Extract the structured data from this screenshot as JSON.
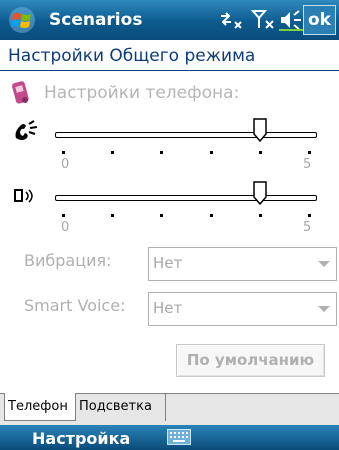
{
  "titlebar": {
    "app_title": "Scenarios",
    "ok_label": "ok",
    "icons": [
      "windows-logo-icon",
      "connectivity-icon",
      "signal-icon",
      "volume-icon"
    ],
    "colors": {
      "bar_top": "#2f89bd",
      "bar_bottom": "#0a4d7c"
    }
  },
  "page": {
    "heading": "Настройки Общего режима"
  },
  "phone_settings": {
    "label": "Настройки телефона:"
  },
  "ringer_volume": {
    "icon": "ringer-icon",
    "min_label": "0",
    "max_label": "5",
    "value": 4
  },
  "notification_volume": {
    "icon": "notification-speaker-icon",
    "min_label": "0",
    "max_label": "5",
    "value": 4
  },
  "vibration": {
    "label": "Вибрация:",
    "value": "Нет"
  },
  "smart_voice": {
    "label": "Smart Voice:",
    "value": "Нет"
  },
  "default_button": {
    "label": "По умолчанию"
  },
  "tabs": [
    {
      "label": "Телефон",
      "active": true
    },
    {
      "label": "Подсветка",
      "active": false
    }
  ],
  "menubar": {
    "softkey_label": "Настройка",
    "input_icon": "keyboard-icon"
  }
}
